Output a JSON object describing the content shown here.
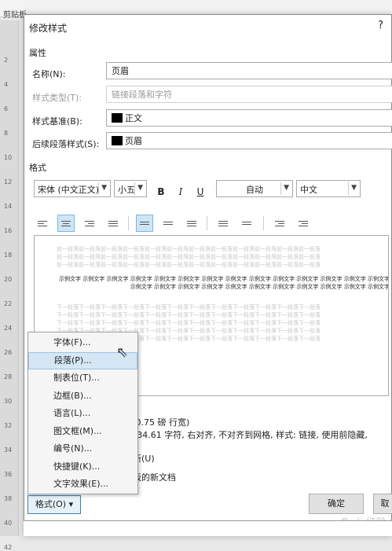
{
  "background": {
    "clipboard_label": "剪贴板",
    "ruler_ticks": [
      "2",
      "4",
      "6",
      "8",
      "10",
      "12",
      "14",
      "16",
      "18",
      "20",
      "22",
      "24",
      "26",
      "28",
      "30",
      "32",
      "34",
      "36",
      "38",
      "40",
      "42"
    ]
  },
  "dialog": {
    "title": "修改样式",
    "help": "?",
    "properties_heading": "属性",
    "name_label": "名称(N):",
    "name_value": "页眉",
    "style_type_label": "样式类型(T):",
    "style_type_value": "链接段落和字符",
    "based_on_label": "样式基准(B):",
    "based_on_value": "正文",
    "next_style_label": "后续段落样式(S):",
    "next_style_value": "页眉",
    "format_heading": "格式",
    "font": "宋体 (中文正文)",
    "size": "小五",
    "bold": "B",
    "italic": "I",
    "underline": "U",
    "color": "自动",
    "language": "中文"
  },
  "preview": {
    "previous_para": "前一段落前一段落前一段落前一段落前一段落前一段落前一段落前一段落前一段落前一段落前一段落前一段落",
    "sample": "示例文字 示例文字 示例文字 示例文字 示例文字 示例文字 示例文字 示例文字 示例文字 示例文字 示例文字 示例文字 示例文字 示例文字 示例文字 示例文字 示例文字 示例文字 示例文字 示例文字 示例文字 示例文字 示例文字 示例文字 示例文字",
    "next_para": "下一段落下一段落下一段落下一段落下一段落下一段落下一段落下一段落下一段落下一段落下一段落下一段落"
  },
  "description": {
    "line1": "乱，  0.75 磅 行宽)",
    "line2": "中 +  34.61 字符, 右对齐, 不对齐到网格, 样式: 链接, 使用前隐藏,",
    "auto_update": "动更新(U)",
    "template_docs": "该模板的新文档"
  },
  "buttons": {
    "format": "格式(O) ▾",
    "ok": "确定",
    "cancel": "取"
  },
  "menu": {
    "items": [
      "字体(F)...",
      "段落(P)...",
      "制表位(T)...",
      "边框(B)...",
      "语言(L)...",
      "图文框(M)...",
      "编号(N)...",
      "快捷键(K)...",
      "文字效果(E)..."
    ],
    "hovered_index": 1
  },
  "watermark": "Bai 经验"
}
